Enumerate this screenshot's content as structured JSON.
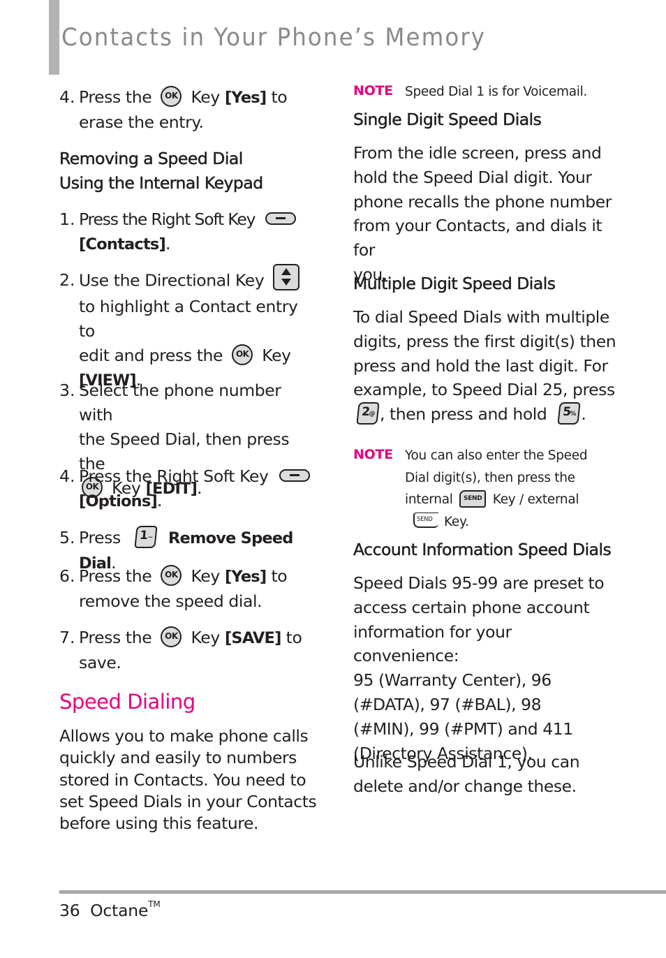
{
  "header": {
    "title": "Contacts in Your Phone’s Memory"
  },
  "left_column": {
    "step_erase": {
      "number": "4.",
      "pre": "Press the",
      "key_icon": "ok-key",
      "key_label": "OK",
      "mid": "Key",
      "action": "[Yes]",
      "post": "to",
      "line2": "erase the entry."
    },
    "subheading": {
      "line1": "Removing a Speed Dial",
      "line2": "Using the Internal Keypad"
    },
    "steps": [
      {
        "number": "1.",
        "text1": "Press the Right Soft Key",
        "icon": "right-soft-key",
        "action": "[Contacts]",
        "end": "."
      },
      {
        "number": "2.",
        "text1": "Use the Directional Key",
        "icon": "directional-key",
        "line2": "to highlight a Contact entry to",
        "line3_pre": "edit and press the",
        "icon2": "ok-key",
        "line3_post": "Key",
        "action": "[VIEW]",
        "end": "."
      },
      {
        "number": "3.",
        "line1": "Select the phone number with",
        "line2": "the Speed Dial, then press the",
        "icon": "ok-key",
        "mid": "Key",
        "action": "[EDIT]",
        "end": "."
      },
      {
        "number": "4.",
        "text1": "Press the Right Soft Key",
        "icon": "right-soft-key",
        "action": "[Options]",
        "end": "."
      },
      {
        "number": "5.",
        "pre": "Press",
        "icon": "key-1",
        "key_digit": "1",
        "key_symbol": "~",
        "action": "Remove Speed Dial",
        "end": "."
      },
      {
        "number": "6.",
        "pre": "Press the",
        "icon": "ok-key",
        "mid": "Key",
        "action": "[Yes]",
        "post": "to",
        "line2": "remove the speed dial."
      },
      {
        "number": "7.",
        "pre": "Press the",
        "icon": "ok-key",
        "mid": "Key",
        "action": "[SAVE]",
        "post": "to",
        "line2": "save."
      }
    ],
    "section": {
      "title": "Speed Dialing",
      "lines": [
        "Allows you to make phone calls",
        "quickly and easily to numbers",
        "stored in Contacts. You need to",
        "set Speed Dials in your Contacts",
        "before using this feature."
      ]
    },
    "ok_label": "OK"
  },
  "right_column": {
    "note1": {
      "label": "NOTE",
      "text": "Speed Dial 1 is for Voicemail."
    },
    "single": {
      "heading": "Single Digit Speed Dials",
      "lines": [
        "From the idle screen, press and",
        "hold the Speed Dial digit. Your",
        "phone recalls the phone number",
        "from your Contacts, and dials it for",
        "you."
      ]
    },
    "multiple": {
      "heading": "Multiple Digit Speed Dials",
      "lines": [
        "To dial Speed Dials with multiple",
        "digits, press the first digit(s) then",
        "press and hold the last digit. For",
        "example, to Speed Dial 25, press"
      ],
      "key1_digit": "2",
      "key1_symbol": "@",
      "middle": ", then press and hold",
      "key2_digit": "5",
      "key2_symbol": "%",
      "end": "."
    },
    "note2": {
      "label": "NOTE",
      "line1": "You can also enter the Speed",
      "line2": "Dial digit(s), then press the",
      "line3_pre": "internal",
      "send_label": "SEND",
      "line3_post": "Key / external",
      "line4": "Key."
    },
    "account": {
      "heading": "Account Information Speed Dials",
      "lines": [
        "Speed Dials 95-99 are preset to",
        "access certain phone account",
        "information for your convenience:",
        "95 (Warranty Center), 96",
        "(#DATA), 97 (#BAL), 98",
        "(#MIN), 99 (#PMT) and 411",
        "(Directory Assistance)."
      ],
      "closing_lines": [
        "Unlike Speed Dial 1, you can",
        "delete and/or change these."
      ]
    }
  },
  "footer": {
    "page_number": "36",
    "product": "Octane",
    "trademark": "TM"
  },
  "colors": {
    "accent": "#e6007e",
    "title_gray": "#8a8a8a",
    "rule_gray": "#a6a6a6",
    "text": "#231f20"
  }
}
